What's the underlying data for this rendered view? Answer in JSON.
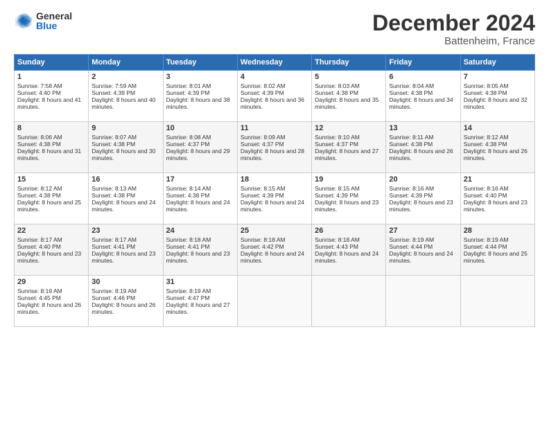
{
  "logo": {
    "general": "General",
    "blue": "Blue"
  },
  "title": "December 2024",
  "location": "Battenheim, France",
  "days_header": [
    "Sunday",
    "Monday",
    "Tuesday",
    "Wednesday",
    "Thursday",
    "Friday",
    "Saturday"
  ],
  "weeks": [
    [
      {
        "day": "1",
        "sunrise": "Sunrise: 7:58 AM",
        "sunset": "Sunset: 4:40 PM",
        "daylight": "Daylight: 8 hours and 41 minutes."
      },
      {
        "day": "2",
        "sunrise": "Sunrise: 7:59 AM",
        "sunset": "Sunset: 4:39 PM",
        "daylight": "Daylight: 8 hours and 40 minutes."
      },
      {
        "day": "3",
        "sunrise": "Sunrise: 8:01 AM",
        "sunset": "Sunset: 4:39 PM",
        "daylight": "Daylight: 8 hours and 38 minutes."
      },
      {
        "day": "4",
        "sunrise": "Sunrise: 8:02 AM",
        "sunset": "Sunset: 4:39 PM",
        "daylight": "Daylight: 8 hours and 36 minutes."
      },
      {
        "day": "5",
        "sunrise": "Sunrise: 8:03 AM",
        "sunset": "Sunset: 4:38 PM",
        "daylight": "Daylight: 8 hours and 35 minutes."
      },
      {
        "day": "6",
        "sunrise": "Sunrise: 8:04 AM",
        "sunset": "Sunset: 4:38 PM",
        "daylight": "Daylight: 8 hours and 34 minutes."
      },
      {
        "day": "7",
        "sunrise": "Sunrise: 8:05 AM",
        "sunset": "Sunset: 4:38 PM",
        "daylight": "Daylight: 8 hours and 32 minutes."
      }
    ],
    [
      {
        "day": "8",
        "sunrise": "Sunrise: 8:06 AM",
        "sunset": "Sunset: 4:38 PM",
        "daylight": "Daylight: 8 hours and 31 minutes."
      },
      {
        "day": "9",
        "sunrise": "Sunrise: 8:07 AM",
        "sunset": "Sunset: 4:38 PM",
        "daylight": "Daylight: 8 hours and 30 minutes."
      },
      {
        "day": "10",
        "sunrise": "Sunrise: 8:08 AM",
        "sunset": "Sunset: 4:37 PM",
        "daylight": "Daylight: 8 hours and 29 minutes."
      },
      {
        "day": "11",
        "sunrise": "Sunrise: 8:09 AM",
        "sunset": "Sunset: 4:37 PM",
        "daylight": "Daylight: 8 hours and 28 minutes."
      },
      {
        "day": "12",
        "sunrise": "Sunrise: 8:10 AM",
        "sunset": "Sunset: 4:37 PM",
        "daylight": "Daylight: 8 hours and 27 minutes."
      },
      {
        "day": "13",
        "sunrise": "Sunrise: 8:11 AM",
        "sunset": "Sunset: 4:38 PM",
        "daylight": "Daylight: 8 hours and 26 minutes."
      },
      {
        "day": "14",
        "sunrise": "Sunrise: 8:12 AM",
        "sunset": "Sunset: 4:38 PM",
        "daylight": "Daylight: 8 hours and 26 minutes."
      }
    ],
    [
      {
        "day": "15",
        "sunrise": "Sunrise: 8:12 AM",
        "sunset": "Sunset: 4:38 PM",
        "daylight": "Daylight: 8 hours and 25 minutes."
      },
      {
        "day": "16",
        "sunrise": "Sunrise: 8:13 AM",
        "sunset": "Sunset: 4:38 PM",
        "daylight": "Daylight: 8 hours and 24 minutes."
      },
      {
        "day": "17",
        "sunrise": "Sunrise: 8:14 AM",
        "sunset": "Sunset: 4:38 PM",
        "daylight": "Daylight: 8 hours and 24 minutes."
      },
      {
        "day": "18",
        "sunrise": "Sunrise: 8:15 AM",
        "sunset": "Sunset: 4:39 PM",
        "daylight": "Daylight: 8 hours and 24 minutes."
      },
      {
        "day": "19",
        "sunrise": "Sunrise: 8:15 AM",
        "sunset": "Sunset: 4:39 PM",
        "daylight": "Daylight: 8 hours and 23 minutes."
      },
      {
        "day": "20",
        "sunrise": "Sunrise: 8:16 AM",
        "sunset": "Sunset: 4:39 PM",
        "daylight": "Daylight: 8 hours and 23 minutes."
      },
      {
        "day": "21",
        "sunrise": "Sunrise: 8:16 AM",
        "sunset": "Sunset: 4:40 PM",
        "daylight": "Daylight: 8 hours and 23 minutes."
      }
    ],
    [
      {
        "day": "22",
        "sunrise": "Sunrise: 8:17 AM",
        "sunset": "Sunset: 4:40 PM",
        "daylight": "Daylight: 8 hours and 23 minutes."
      },
      {
        "day": "23",
        "sunrise": "Sunrise: 8:17 AM",
        "sunset": "Sunset: 4:41 PM",
        "daylight": "Daylight: 8 hours and 23 minutes."
      },
      {
        "day": "24",
        "sunrise": "Sunrise: 8:18 AM",
        "sunset": "Sunset: 4:41 PM",
        "daylight": "Daylight: 8 hours and 23 minutes."
      },
      {
        "day": "25",
        "sunrise": "Sunrise: 8:18 AM",
        "sunset": "Sunset: 4:42 PM",
        "daylight": "Daylight: 8 hours and 24 minutes."
      },
      {
        "day": "26",
        "sunrise": "Sunrise: 8:18 AM",
        "sunset": "Sunset: 4:43 PM",
        "daylight": "Daylight: 8 hours and 24 minutes."
      },
      {
        "day": "27",
        "sunrise": "Sunrise: 8:19 AM",
        "sunset": "Sunset: 4:44 PM",
        "daylight": "Daylight: 8 hours and 24 minutes."
      },
      {
        "day": "28",
        "sunrise": "Sunrise: 8:19 AM",
        "sunset": "Sunset: 4:44 PM",
        "daylight": "Daylight: 8 hours and 25 minutes."
      }
    ],
    [
      {
        "day": "29",
        "sunrise": "Sunrise: 8:19 AM",
        "sunset": "Sunset: 4:45 PM",
        "daylight": "Daylight: 8 hours and 26 minutes."
      },
      {
        "day": "30",
        "sunrise": "Sunrise: 8:19 AM",
        "sunset": "Sunset: 4:46 PM",
        "daylight": "Daylight: 8 hours and 26 minutes."
      },
      {
        "day": "31",
        "sunrise": "Sunrise: 8:19 AM",
        "sunset": "Sunset: 4:47 PM",
        "daylight": "Daylight: 8 hours and 27 minutes."
      },
      null,
      null,
      null,
      null
    ]
  ]
}
